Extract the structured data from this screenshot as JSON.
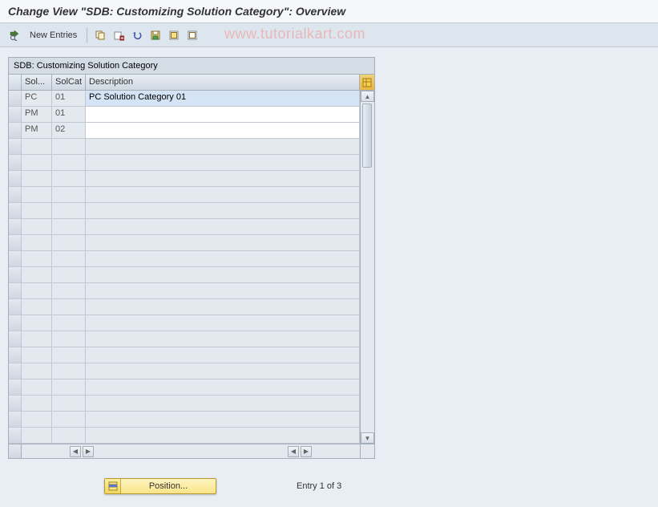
{
  "title": "Change View \"SDB: Customizing Solution Category\": Overview",
  "toolbar": {
    "new_entries": "New Entries"
  },
  "watermark": "www.tutorialkart.com",
  "grid": {
    "caption": "SDB: Customizing Solution Category",
    "columns": {
      "sol": "Sol...",
      "solcat": "SolCat",
      "desc": "Description"
    },
    "rows": [
      {
        "sol": "PC",
        "solcat": "01",
        "desc": "PC Solution Category 01",
        "highlighted": true
      },
      {
        "sol": "PM",
        "solcat": "01",
        "desc": ""
      },
      {
        "sol": "PM",
        "solcat": "02",
        "desc": ""
      }
    ],
    "empty_rows": 19
  },
  "footer": {
    "position_label": "Position...",
    "entry_text": "Entry 1 of 3"
  }
}
